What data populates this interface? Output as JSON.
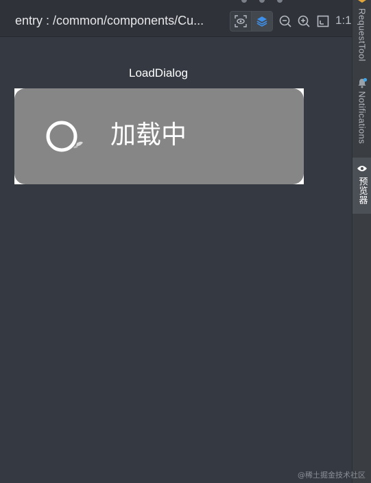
{
  "toolbar": {
    "title": "entry : /common/components/Cu...",
    "ratio_label": "1:1",
    "icons": [
      "inspect-icon",
      "layers-icon",
      "zoom-out-icon",
      "zoom-in-icon",
      "fit-screen-icon"
    ]
  },
  "preview": {
    "component_name": "LoadDialog",
    "dialog": {
      "loading_text": "加载中",
      "background_color": "#868686",
      "spinner_icon": "loading-spinner-icon"
    }
  },
  "sidebar": {
    "tabs": [
      {
        "label": "RequestTool",
        "icon": "request-tool-icon",
        "active": false
      },
      {
        "label": "Notifications",
        "icon": "bell-icon",
        "active": false
      },
      {
        "label": "预览器",
        "icon": "eye-icon",
        "active": true
      }
    ]
  },
  "watermark": "@稀土掘金技术社区",
  "colors": {
    "accent": "#3d8fe8",
    "toolbar_bg": "#2f3238",
    "canvas_bg": "#353a42",
    "sidebar_bg": "#3a3d42"
  }
}
